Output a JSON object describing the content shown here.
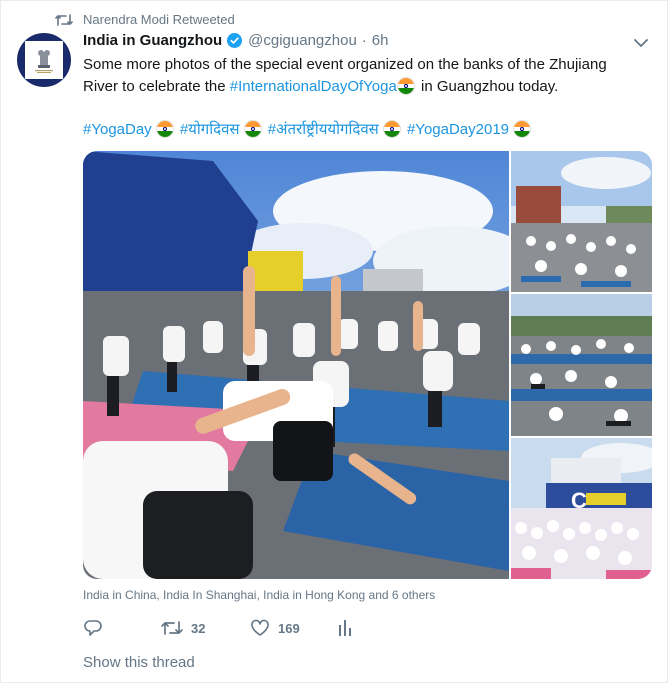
{
  "retweet": {
    "label": "Narendra Modi Retweeted",
    "icon": "retweet-icon"
  },
  "author": {
    "avatar_icon": "emblem-logo",
    "name": "India in Guangzhou",
    "verified_icon": "verified-badge-icon",
    "handle": "@cgiguangzhou",
    "separator": "·",
    "time": "6h"
  },
  "menu_icon": "chevron-down-icon",
  "tweet": {
    "text_before": "Some more photos of the special event organized on the banks of the Zhujiang River to celebrate the ",
    "hashtag": "#InternationalDayOfYoga",
    "text_after": " in Guangzhou today."
  },
  "hashtags": [
    "#YogaDay",
    "#योगदिवस",
    "#अंतर्राष्ट्रीययोगदिवस",
    "#YogaDay2019"
  ],
  "media": {
    "photos": [
      "yoga-photo-riverbank-main",
      "yoga-photo-crowd-plaza",
      "yoga-photo-rows-mats",
      "yoga-photo-group-ship"
    ]
  },
  "tagged_line": "India in China, India In Shanghai, India in Hong Kong and 6 others",
  "actions": {
    "reply_icon": "reply-icon",
    "retweet_icon": "retweet-icon",
    "retweet_count": "32",
    "like_icon": "heart-icon",
    "like_count": "169",
    "analytics_icon": "analytics-icon"
  },
  "show_thread": "Show this thread",
  "colors": {
    "link": "#1b95e0",
    "muted": "#657786",
    "text": "#14171a",
    "emblem_bg": "#1b2a6b"
  }
}
